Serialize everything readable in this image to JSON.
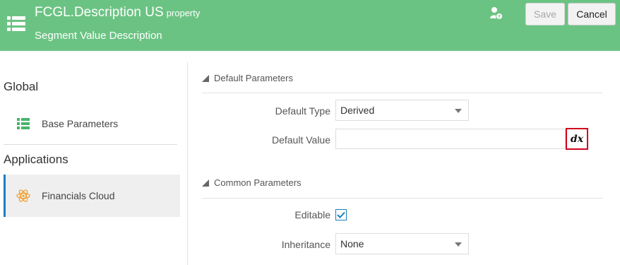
{
  "header": {
    "title": "FCGL.Description US",
    "title_suffix": "property",
    "subtitle": "Segment Value Description",
    "menu_icon": "list-icon",
    "user_help_icon": "user-help-icon",
    "save_label": "Save",
    "cancel_label": "Cancel",
    "background": "#6bc383"
  },
  "sidebar": {
    "global_heading": "Global",
    "applications_heading": "Applications",
    "items": [
      {
        "label": "Base Parameters",
        "icon": "list-icon",
        "selected": false
      },
      {
        "label": "Financials Cloud",
        "icon": "atom-icon",
        "selected": true
      }
    ]
  },
  "default_parameters": {
    "title": "Default Parameters",
    "default_type_label": "Default Type",
    "default_type_value": "Derived",
    "default_value_label": "Default Value",
    "default_value": "",
    "derive_button_label": "dx"
  },
  "common_parameters": {
    "title": "Common Parameters",
    "editable_label": "Editable",
    "editable_checked": true,
    "inheritance_label": "Inheritance",
    "inheritance_value": "None"
  }
}
